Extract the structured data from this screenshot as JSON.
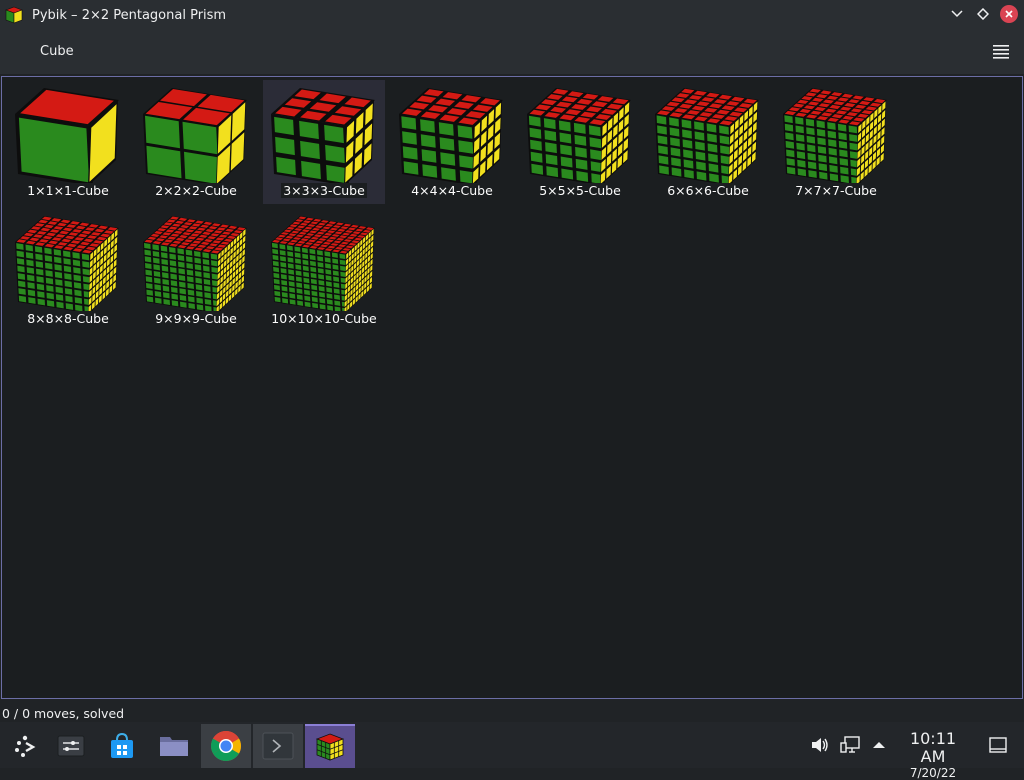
{
  "window": {
    "title": "Pybik – 2×2 Pentagonal Prism"
  },
  "menu": {
    "cube_label": "Cube"
  },
  "puzzles": [
    {
      "label": "1×1×1-Cube",
      "n": 1,
      "selected": false
    },
    {
      "label": "2×2×2-Cube",
      "n": 2,
      "selected": false
    },
    {
      "label": "3×3×3-Cube",
      "n": 3,
      "selected": true
    },
    {
      "label": "4×4×4-Cube",
      "n": 4,
      "selected": false
    },
    {
      "label": "5×5×5-Cube",
      "n": 5,
      "selected": false
    },
    {
      "label": "6×6×6-Cube",
      "n": 6,
      "selected": false
    },
    {
      "label": "7×7×7-Cube",
      "n": 7,
      "selected": false
    },
    {
      "label": "8×8×8-Cube",
      "n": 8,
      "selected": false
    },
    {
      "label": "9×9×9-Cube",
      "n": 9,
      "selected": false
    },
    {
      "label": "10×10×10-Cube",
      "n": 10,
      "selected": false
    }
  ],
  "status": {
    "text": "0 / 0 moves, solved"
  },
  "taskbar": {
    "apps": [
      {
        "name": "app-launcher-icon"
      },
      {
        "name": "system-settings-icon"
      },
      {
        "name": "store-icon"
      },
      {
        "name": "file-manager-icon"
      },
      {
        "name": "chrome-icon"
      },
      {
        "name": "terminal-icon"
      },
      {
        "name": "pybik-icon"
      }
    ],
    "tray": [
      "volume-icon",
      "network-icon",
      "tray-expand-icon"
    ],
    "time": "10:11 AM",
    "date": "7/20/22"
  },
  "colors": {
    "top": "#d41a14",
    "front": "#2a8a1e",
    "right": "#f2e01e",
    "selection": "#2b2c37",
    "accent": "#6c6ea6"
  }
}
